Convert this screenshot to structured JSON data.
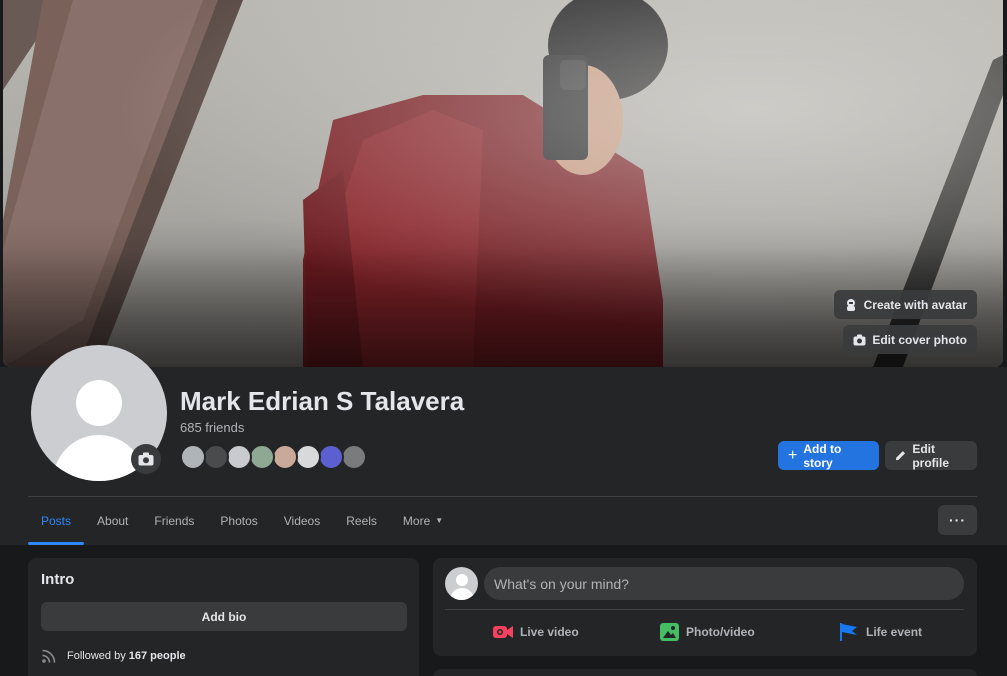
{
  "cover": {
    "create_avatar_label": "Create with avatar",
    "edit_cover_label": "Edit cover photo"
  },
  "profile": {
    "name": "Mark Edrian S Talavera",
    "friends_count": "685 friends",
    "friend_avatar_colors": [
      "#b0b3b8",
      "#4a4b4d",
      "#c8cacd",
      "#8fa893",
      "#c9a99a",
      "#d8d9db",
      "#5b5fcf",
      "#7a7b7d"
    ]
  },
  "actions": {
    "add_to_story": "Add to story",
    "edit_profile": "Edit profile"
  },
  "tabs": [
    {
      "label": "Posts"
    },
    {
      "label": "About"
    },
    {
      "label": "Friends"
    },
    {
      "label": "Photos"
    },
    {
      "label": "Videos"
    },
    {
      "label": "Reels"
    },
    {
      "label": "More"
    }
  ],
  "more_menu_label": "···",
  "intro": {
    "title": "Intro",
    "add_bio": "Add bio",
    "followed_prefix": "Followed by ",
    "followed_count": "167 people"
  },
  "composer": {
    "placeholder": "What's on your mind?",
    "live_video": "Live video",
    "photo_video": "Photo/video",
    "life_event": "Life event"
  },
  "colors": {
    "accent": "#2d88ff",
    "button_blue": "#2374e1",
    "live_red": "#f3425f",
    "photo_green": "#45bd62",
    "life_blue": "#1877f2"
  }
}
